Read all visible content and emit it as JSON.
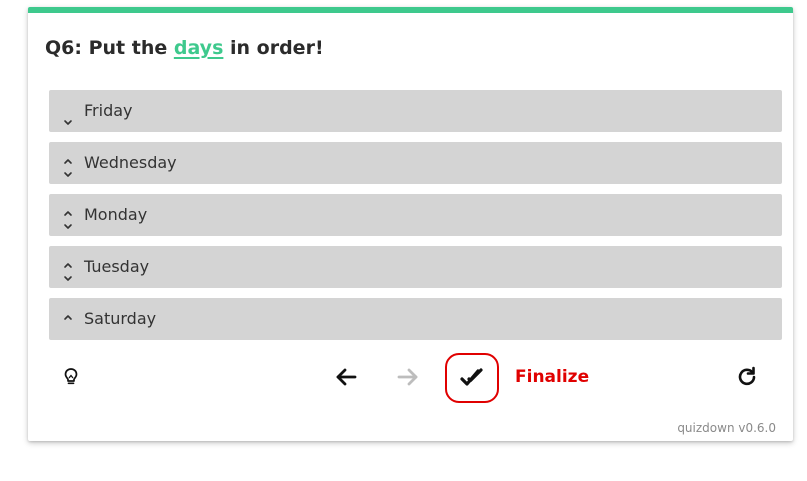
{
  "question": {
    "prefix": "Q6: Put the ",
    "link": "days",
    "suffix": " in order!"
  },
  "items": [
    {
      "label": "Friday",
      "can_up": false,
      "can_down": true
    },
    {
      "label": "Wednesday",
      "can_up": true,
      "can_down": true
    },
    {
      "label": "Monday",
      "can_up": true,
      "can_down": true
    },
    {
      "label": "Tuesday",
      "can_up": true,
      "can_down": true
    },
    {
      "label": "Saturday",
      "can_up": true,
      "can_down": false
    }
  ],
  "controls": {
    "finalize_label": "Finalize",
    "icons": {
      "hint": "lightbulb-icon",
      "back": "arrow-left-icon",
      "forward": "arrow-right-icon",
      "check": "double-check-icon",
      "reset": "refresh-icon"
    }
  },
  "footer": {
    "version": "quizdown v0.6.0"
  },
  "colors": {
    "accent": "#3ec98d",
    "item_bg": "#d4d4d4",
    "danger": "#e00000",
    "disabled": "#bdbdbd"
  }
}
